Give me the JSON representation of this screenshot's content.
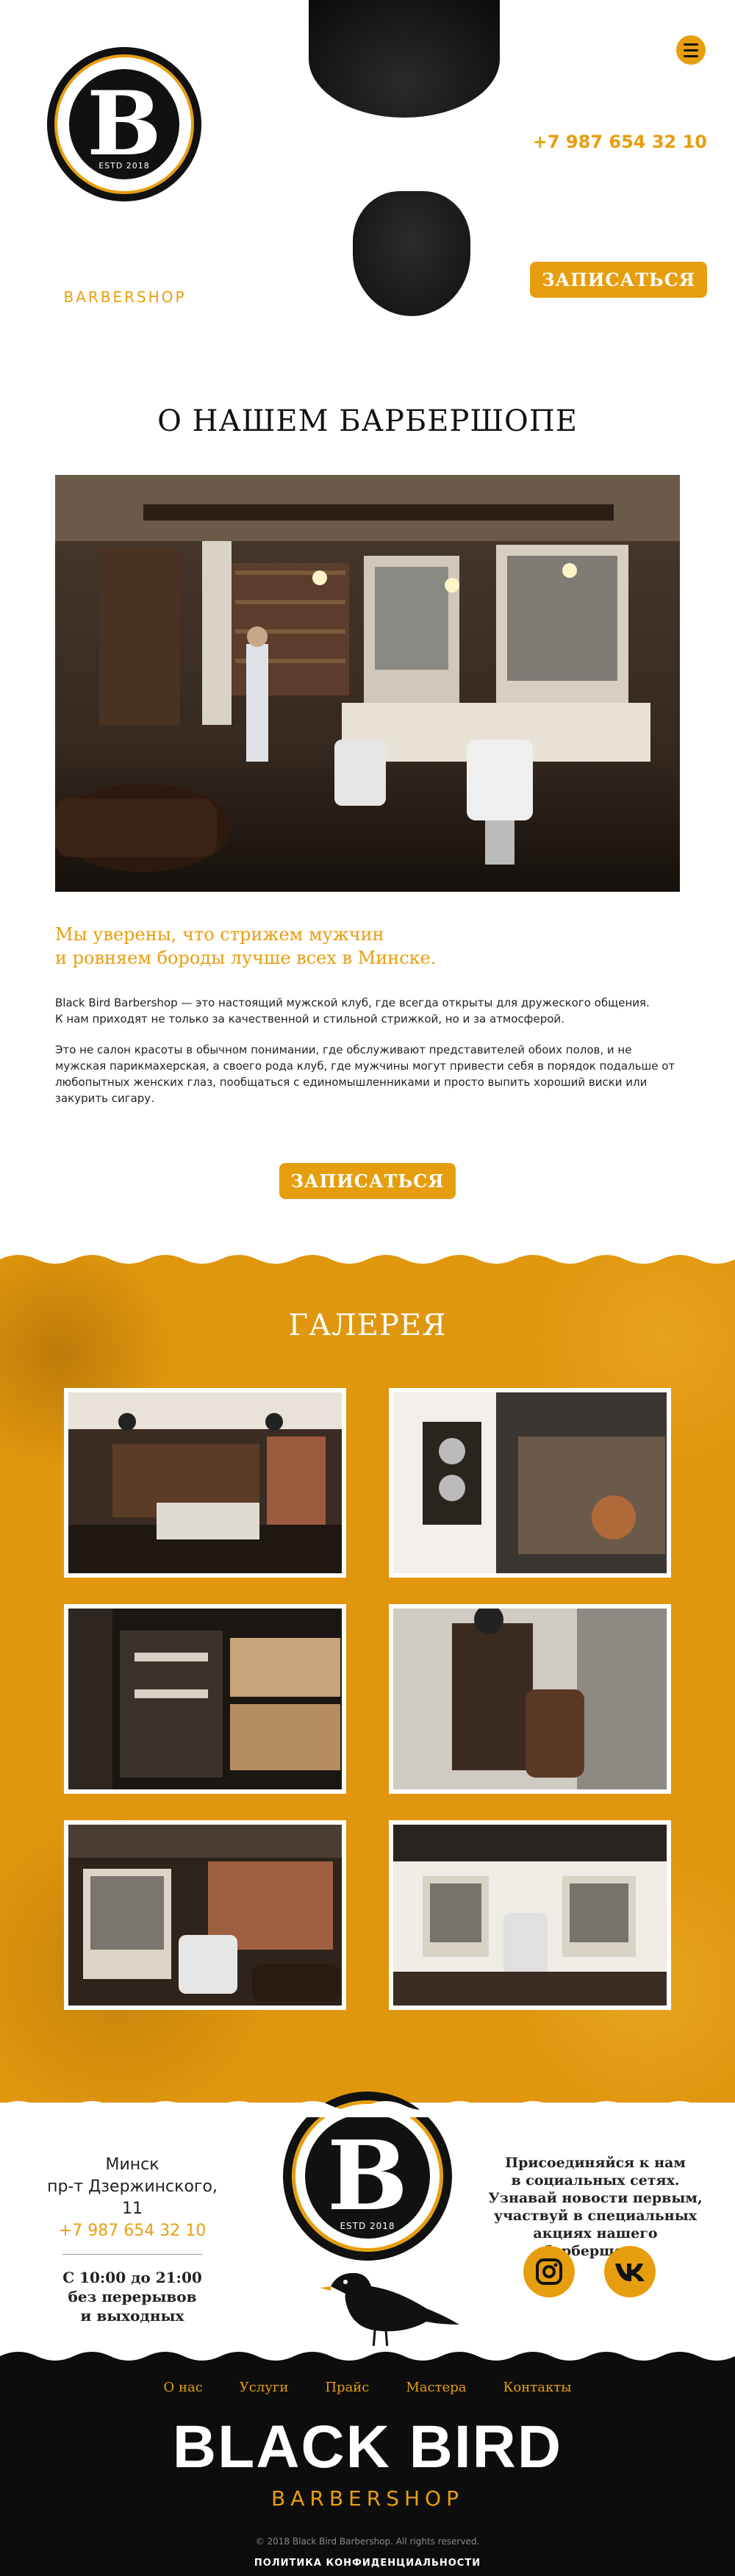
{
  "header": {
    "logo_badge_letter": "B",
    "logo_estd": "ESTD 2018",
    "logo_title": "BLACK BIRD",
    "logo_subtitle": "BARBERSHOP",
    "city": "Минск",
    "address": "пр-т Дзержинского, 11",
    "phone": "+7 987 654 32 10",
    "book_label": "ЗАПИСАТЬСЯ",
    "menu_icon": "hamburger-icon"
  },
  "about": {
    "title": "О НАШЕМ БАРБЕРШОПЕ",
    "lead_line1": "Мы уверены, что стрижем мужчин",
    "lead_line2": "и ровняем бороды лучше всех в Минске.",
    "para1_line1": "Black Bird Barbershop — это настоящий мужской клуб, где всегда открыты для дружеского общения.",
    "para1_line2": "К нам приходят не только за качественной и стильной стрижкой, но и за атмосферой.",
    "para2": "Это не салон красоты в обычном понимании, где обслуживают представителей обоих полов, и не мужская парикмахерская, а своего рода клуб, где мужчины могут привести себя в порядок подальше от любопытных женских глаз, пообщаться с единомышленниками и просто выпить хороший виски или закурить сигару.",
    "book_label": "ЗАПИСАТЬСЯ"
  },
  "gallery": {
    "title": "ГАЛЕРЕЯ"
  },
  "info": {
    "city": "Минск",
    "address": "пр-т Дзержинского, 11",
    "phone": "+7 987 654 32 10",
    "hours": "С 10:00 до 21:00",
    "no_breaks_1": "без перерывов",
    "no_breaks_2": "и выходных",
    "logo_badge_letter": "B",
    "logo_estd": "ESTD 2018",
    "social_1": "Присоединяйся к нам",
    "social_2": "в социальных сетях.",
    "social_3": "Узнавай новости первым,",
    "social_4": "участвуй в специальных",
    "social_5": "акциях нашего барбершопа.",
    "instagram_icon": "instagram-icon",
    "vk_icon": "vk-icon"
  },
  "footer": {
    "nav": [
      "О нас",
      "Услуги",
      "Прайс",
      "Мастера",
      "Контакты"
    ],
    "title": "BLACK BIRD",
    "subtitle": "BARBERSHOP",
    "copyright": "© 2018 Black Bird Barbershop. All rights reserved.",
    "policy": "ПОЛИТИКА КОНФИДЕНЦИАЛЬНОСТИ"
  },
  "colors": {
    "accent": "#e79e0e",
    "dark": "#0d0d0d",
    "gallery_bg": "#e0960d"
  }
}
